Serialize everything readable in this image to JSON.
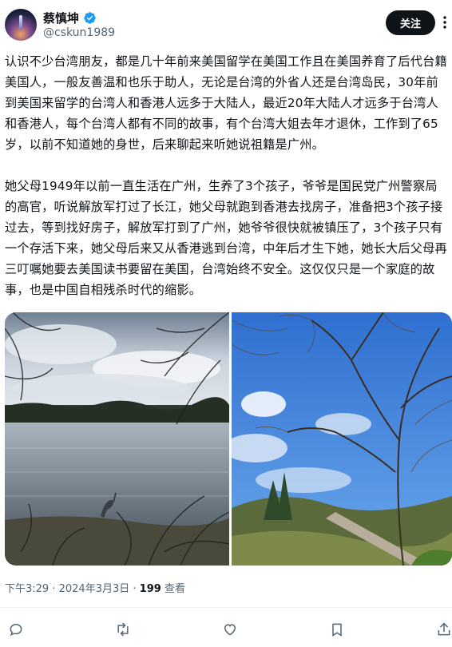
{
  "user": {
    "display_name": "蔡慎坤",
    "handle": "@cskun1989",
    "follow_label": "关注"
  },
  "tweet": {
    "paragraph1": "认识不少台湾朋友，都是几十年前来美国留学在美国工作且在美国养育了后代台籍美国人，一般友善温和也乐于助人，无论是台湾的外省人还是台湾岛民，30年前到美国来留学的台湾人和香港人远多于大陆人，最近20年大陆人才远多于台湾人和香港人，每个台湾人都有不同的故事，有个台湾大姐去年才退休，工作到了65岁，以前不知道她的身世，后来聊起来听她说祖籍是广州。",
    "paragraph2": "她父母1949年以前一直生活在广州，生养了3个孩子，爷爷是国民党广州警察局的高官，听说解放军打过了长江，她父母就跑到香港去找房子，准备把3个孩子接过去，等到找好房子，解放军打到了广州，她爷爷很快就被镇压了，3个孩子只有一个存活下来，她父母后来又从香港逃到台湾，中年后才生下她，她长大后父母再三叮嘱她要去美国读书要留在美国，台湾始终不安全。这仅仅只是一个家庭的故事，也是中国自相残杀时代的缩影。",
    "time": "下午3:29",
    "separator": " · ",
    "date": "2024年3月3日",
    "views_count": "199",
    "views_label": " 查看"
  },
  "icons": {
    "verified": "verified-badge-icon",
    "more": "more-icon",
    "reply": "reply-icon",
    "retweet": "retweet-icon",
    "like": "like-icon",
    "bookmark": "bookmark-icon",
    "share": "share-icon"
  },
  "colors": {
    "accent": "#1d9bf0",
    "text": "#0f1419",
    "muted": "#536471",
    "button_bg": "#0f1419"
  }
}
